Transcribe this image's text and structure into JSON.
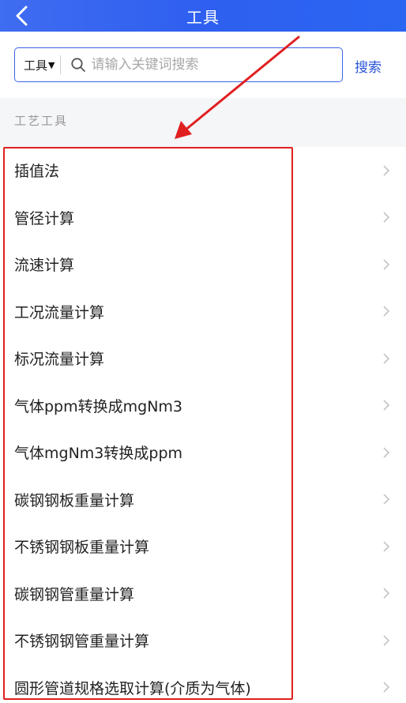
{
  "header": {
    "title": "工具",
    "back_icon": "chevron-left-icon"
  },
  "search": {
    "scope_label": "工具",
    "placeholder": "请输入关键词搜索",
    "value": "",
    "button_label": "搜索"
  },
  "section": {
    "title": "工艺工具",
    "items": [
      {
        "label": "插值法"
      },
      {
        "label": "管径计算"
      },
      {
        "label": "流速计算"
      },
      {
        "label": "工况流量计算"
      },
      {
        "label": "标况流量计算"
      },
      {
        "label": "气体ppm转换成mgNm3"
      },
      {
        "label": "气体mgNm3转换成ppm"
      },
      {
        "label": "碳钢钢板重量计算"
      },
      {
        "label": "不锈钢钢板重量计算"
      },
      {
        "label": "碳钢钢管重量计算"
      },
      {
        "label": "不锈钢钢管重量计算"
      },
      {
        "label": "圆形管道规格选取计算(介质为气体)"
      }
    ]
  },
  "colors": {
    "header": "#2f5ff0",
    "accent": "#2b55d8",
    "annotation": "#e02020"
  }
}
